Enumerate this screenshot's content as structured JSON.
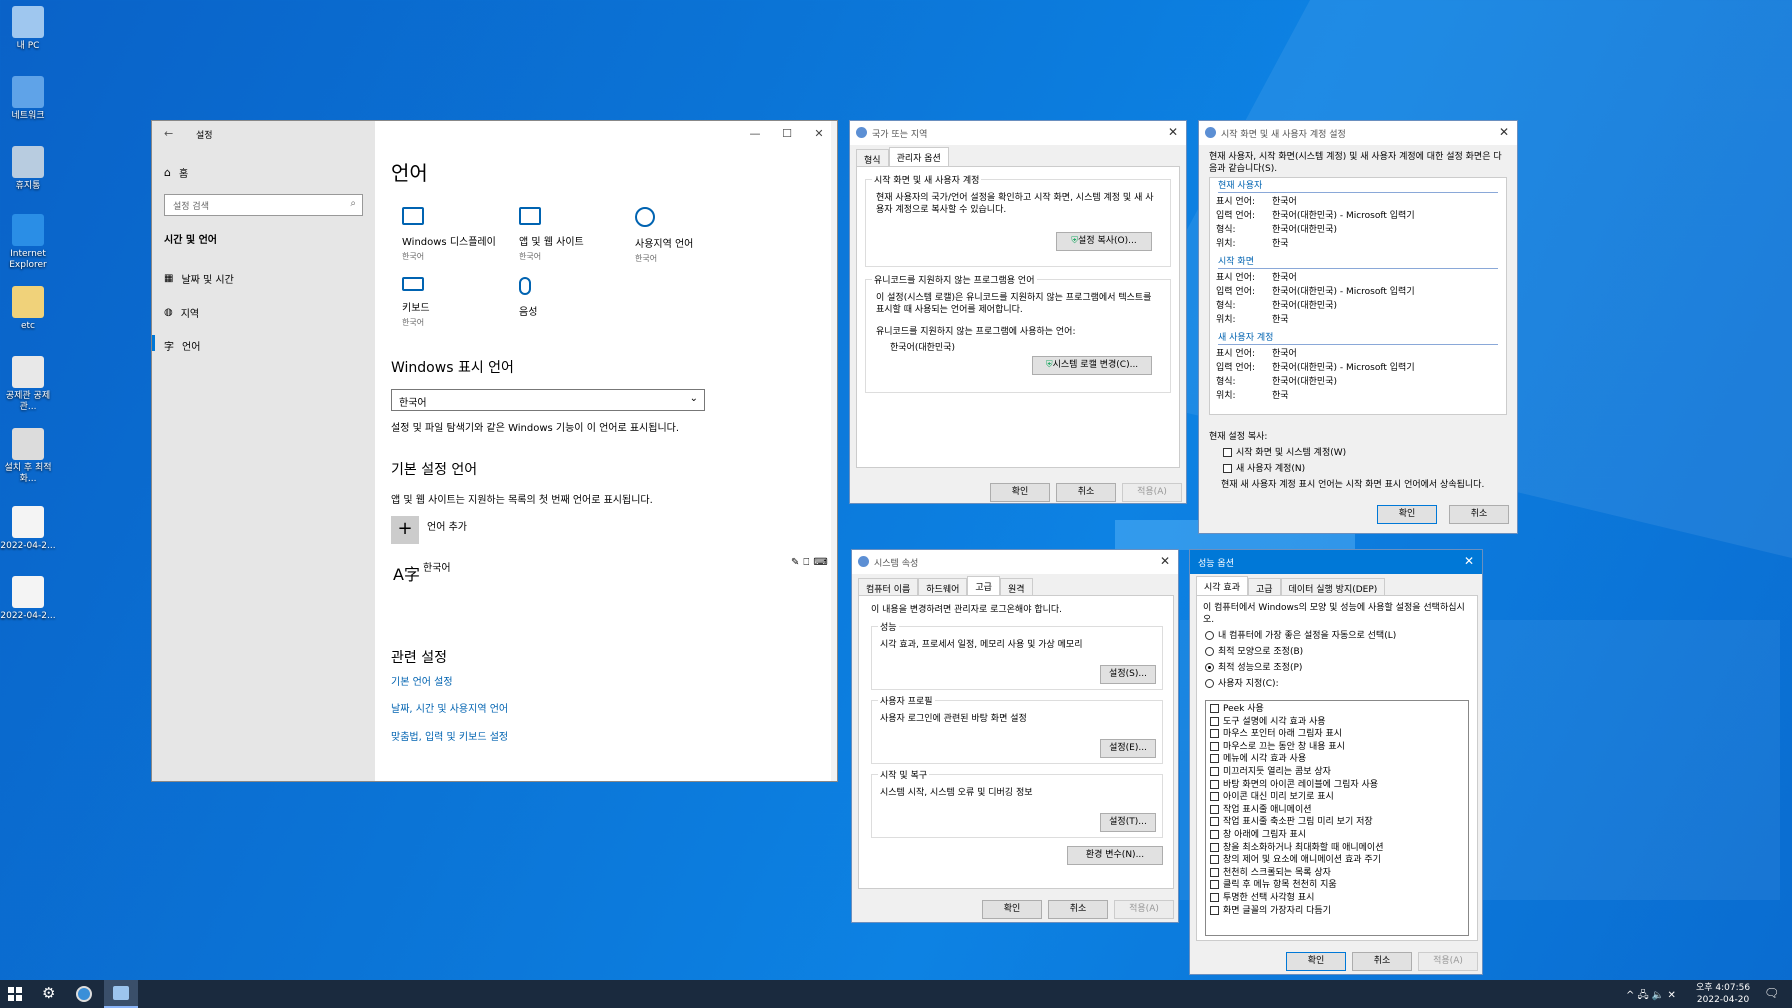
{
  "desktop": {
    "icons": [
      {
        "label": "내 PC",
        "color": "#9fc7ef"
      },
      {
        "label": "네트워크",
        "color": "#5fa3e8"
      },
      {
        "label": "휴지통",
        "color": "#b8cce0"
      },
      {
        "label": "Internet Explorer",
        "color": "#2a8ee6"
      },
      {
        "label": "etc",
        "color": "#f0d27a"
      },
      {
        "label": "공제관 공제관...",
        "color": "#e8e8e8"
      },
      {
        "label": "설치 후 최적화...",
        "color": "#dcdcdc"
      },
      {
        "label": "2022-04-2...",
        "color": "#f4f4f4"
      },
      {
        "label": "2022-04-2...",
        "color": "#f4f4f4"
      }
    ]
  },
  "settings": {
    "title": "설정",
    "back": "←",
    "minimize": "—",
    "maximize": "☐",
    "close": "✕",
    "home": "홈",
    "search_placeholder": "설정 검색",
    "section": "시간 및 언어",
    "nav": [
      {
        "label": "날짜 및 시간"
      },
      {
        "label": "지역"
      },
      {
        "label": "언어"
      }
    ],
    "page_title": "언어",
    "tiles": [
      {
        "label": "Windows 디스플레이",
        "sub": "한국어"
      },
      {
        "label": "앱 및 웹 사이트",
        "sub": "한국어"
      },
      {
        "label": "사용지역 언어",
        "sub": "한국어"
      },
      {
        "label": "키보드",
        "sub": "한국어"
      },
      {
        "label": "음성",
        "sub": ""
      }
    ],
    "display_lang_heading": "Windows 표시 언어",
    "display_lang_value": "한국어",
    "display_lang_desc": "설정 및 파일 탐색기와 같은 Windows 기능이 이 언어로 표시됩니다.",
    "pref_heading": "기본 설정 언어",
    "pref_desc": "앱 및 웹 사이트는 지원하는 목록의 첫 번째 언어로 표시됩니다.",
    "add_lang": "언어 추가",
    "lang_item": "한국어",
    "related_heading": "관련 설정",
    "related_links": [
      "기본 언어 설정",
      "날짜, 시간 및 사용지역 언어",
      "맞춤법, 입력 및 키보드 설정"
    ]
  },
  "region": {
    "title": "국가 또는 지역",
    "tabs": [
      "형식",
      "관리자 옵션"
    ],
    "group1_title": "시작 화면 및 새 사용자 계정",
    "group1_text": "현재 사용자의 국가/언어 설정을 확인하고 시작 화면, 시스템 계정 및 새 사용자 계정으로 복사할 수 있습니다.",
    "copy_btn": "설정 복사(O)...",
    "group2_title": "유니코드를 지원하지 않는 프로그램용 언어",
    "group2_text": "이 설정(시스템 로캘)은 유니코드를 지원하지 않는 프로그램에서 텍스트를 표시할 때 사용되는 언어를 제어합니다.",
    "current_label": "유니코드를 지원하지 않는 프로그램에 사용하는 언어:",
    "current_value": "한국어(대한민국)",
    "locale_btn": "시스템 로캘 변경(C)...",
    "ok": "확인",
    "cancel": "취소",
    "apply": "적용(A)"
  },
  "welcome": {
    "title": "시작 화면 및 새 사용자 계정 설정",
    "intro": "현재 사용자, 시작 화면(시스템 계정) 및 새 사용자 계정에 대한 설정 화면은 다음과 같습니다(S).",
    "sections": [
      {
        "heading": "현재 사용자",
        "rows": [
          [
            "표시 언어:",
            "한국어"
          ],
          [
            "입력 언어:",
            "한국어(대한민국) - Microsoft 입력기"
          ],
          [
            "형식:",
            "한국어(대한민국)"
          ],
          [
            "위치:",
            "한국"
          ]
        ]
      },
      {
        "heading": "시작 화면",
        "rows": [
          [
            "표시 언어:",
            "한국어"
          ],
          [
            "입력 언어:",
            "한국어(대한민국) - Microsoft 입력기"
          ],
          [
            "형식:",
            "한국어(대한민국)"
          ],
          [
            "위치:",
            "한국"
          ]
        ]
      },
      {
        "heading": "새 사용자 계정",
        "rows": [
          [
            "표시 언어:",
            "한국어"
          ],
          [
            "입력 언어:",
            "한국어(대한민국) - Microsoft 입력기"
          ],
          [
            "형식:",
            "한국어(대한민국)"
          ],
          [
            "위치:",
            "한국"
          ]
        ]
      }
    ],
    "copy_label": "현재 설정 복사:",
    "cb1": "시작 화면 및 시스템 계정(W)",
    "cb2": "새 사용자 계정(N)",
    "note": "현재 새 사용자 계정 표시 언어는 시작 화면 표시 언어에서 상속됩니다.",
    "ok": "확인",
    "cancel": "취소"
  },
  "sysprops": {
    "title": "시스템 속성",
    "tabs": [
      "컴퓨터 이름",
      "하드웨어",
      "고급",
      "원격"
    ],
    "admin_note": "이 내용을 변경하려면 관리자로 로그온해야 합니다.",
    "groups": [
      {
        "title": "성능",
        "text": "시각 효과, 프로세서 일정, 메모리 사용 및 가상 메모리",
        "btn": "설정(S)..."
      },
      {
        "title": "사용자 프로필",
        "text": "사용자 로그인에 관련된 바탕 화면 설정",
        "btn": "설정(E)..."
      },
      {
        "title": "시작 및 복구",
        "text": "시스템 시작, 시스템 오류 및 디버깅 정보",
        "btn": "설정(T)..."
      }
    ],
    "env_btn": "환경 변수(N)...",
    "ok": "확인",
    "cancel": "취소",
    "apply": "적용(A)"
  },
  "perf": {
    "title": "성능 옵션",
    "tabs": [
      "시각 효과",
      "고급",
      "데이터 실행 방지(DEP)"
    ],
    "intro": "이 컴퓨터에서 Windows의 모양 및 성능에 사용할 설정을 선택하십시오.",
    "radios": [
      "내 컴퓨터에 가장 좋은 설정을 자동으로 선택(L)",
      "최적 모양으로 조정(B)",
      "최적 성능으로 조정(P)",
      "사용자 지정(C):"
    ],
    "selected_radio": "최적 성능으로 조정(P)",
    "options": [
      "Peek 사용",
      "도구 설명에 시각 효과 사용",
      "마우스 포인터 아래 그림자 표시",
      "마우스로 끄는 동안 창 내용 표시",
      "메뉴에 시각 효과 사용",
      "미끄러지듯 열리는 콤보 상자",
      "바탕 화면의 아이콘 레이블에 그림자 사용",
      "아이콘 대신 미리 보기로 표시",
      "작업 표시줄 애니메이션",
      "작업 표시줄 축소판 그림 미리 보기 저장",
      "창 아래에 그림자 표시",
      "창을 최소화하거나 최대화할 때 애니메이션",
      "창의 제어 및 요소에 애니메이션 효과 주기",
      "천천히 스크롤되는 목록 상자",
      "클릭 후 메뉴 항목 천천히 지움",
      "투명한 선택 사각형 표시",
      "화면 글꼴의 가장자리 다듬기"
    ],
    "ok": "확인",
    "cancel": "취소",
    "apply": "적용(A)"
  },
  "taskbar": {
    "time": "오후 4:07:56",
    "date": "2022-04-20",
    "start_icon": "windows-logo",
    "tray": "^ 🖧 🔈 ✕"
  }
}
